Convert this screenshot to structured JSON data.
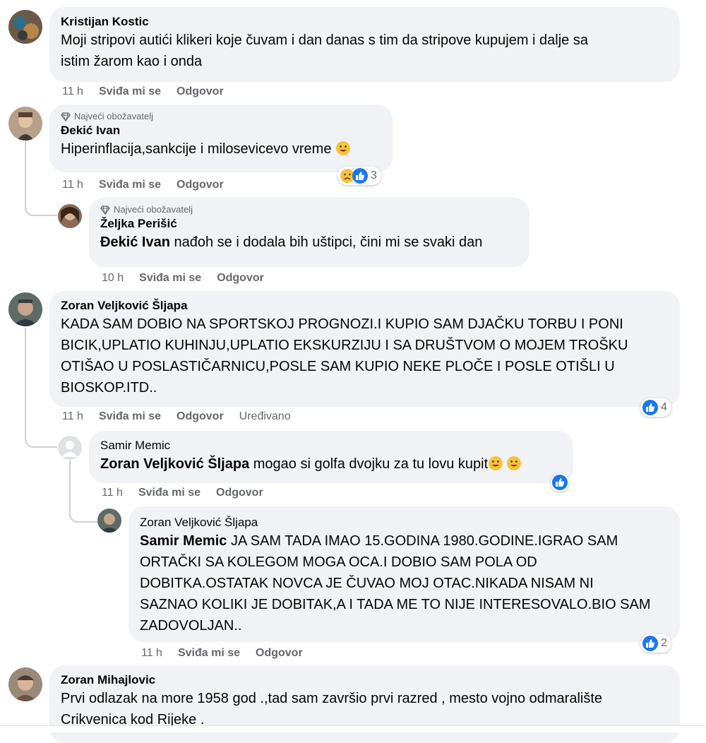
{
  "comments": [
    {
      "name": "Kristijan Kostic",
      "line1": "Moji stripovi autići klikeri koje čuvam i dan danas s tim da stripove kupujem i dalje sa",
      "line2": "istim žarom kao i onda",
      "time": "11 h",
      "like": "Sviđa mi se",
      "reply": "Odgovor"
    },
    {
      "badge": "Najveći obožavatelj",
      "name": "Đekić Ivan",
      "text": "Hiperinflacija,sankcije i milosevicevo vreme",
      "time": "11 h",
      "like": "Sviđa mi se",
      "reply": "Odgovor",
      "reaction_count": "3"
    },
    {
      "badge": "Najveći obožavatelj",
      "name": "Željka Perišić",
      "mention": "Đekić Ivan",
      "text": " nađoh se i dodala bih uštipci, čini mi se svaki dan",
      "time": "10 h",
      "like": "Sviđa mi se",
      "reply": "Odgovor"
    },
    {
      "name": "Zoran Veljković Šljapa",
      "lines": [
        "KADA SAM DOBIO NA SPORTSKOJ PROGNOZI.I KUPIO SAM DJAČKU TORBU I PONI",
        "BICIK,UPLATIO KUHINJU,UPLATIO EKSKURZIJU I SA DRUŠTVOM O MOJEM TROŠKU",
        "OTIŠAO U POSLASTIČARNICU,POSLE SAM KUPIO NEKE PLOČE I POSLE OTIŠLI U",
        "BIOSKOP.ITD.."
      ],
      "time": "11 h",
      "like": "Sviđa mi se",
      "reply": "Odgovor",
      "edited": "Uređivano",
      "reaction_count": "4"
    },
    {
      "name": "Samir Memic",
      "mention": "Zoran Veljković Šljapa",
      "text": " mogao si golfa dvojku za tu lovu kupit",
      "time": "11 h",
      "like": "Sviđa mi se",
      "reply": "Odgovor"
    },
    {
      "name": "Zoran Veljković Šljapa",
      "mention": "Samir Memic",
      "line1": " JA SAM TADA IMAO 15.GODINA 1980.GODINE.IGRAO SAM",
      "lines": [
        "ORTAČKI SA KOLEGOM MOGA OCA.I DOBIO SAM POLA OD",
        "DOBITKA.OSTATAK NOVCA JE ČUVAO MOJ OTAC.NIKADA NISAM NI",
        "SAZNAO KOLIKI JE DOBITAK,A I TADA ME TO NIJE INTERESOVALO.BIO SAM",
        "ZADOVOLJAN.."
      ],
      "time": "11 h",
      "like": "Sviđa mi se",
      "reply": "Odgovor",
      "reaction_count": "2"
    },
    {
      "name": "Zoran Mihajlovic",
      "line1": "Prvi odlazak na more 1958 god .,tad sam završio prvi razred , mesto vojno odmaralište",
      "line2": "Crikvenica kod Rijeke ."
    }
  ],
  "icons": {
    "like": "like-icon",
    "sad": "sad-face-icon",
    "smile": "smiling-face-icon",
    "badge": "diamond-icon"
  },
  "colors": {
    "like_blue": "#1877f2",
    "bubble": "#f0f2f5",
    "meta": "#65676b"
  }
}
